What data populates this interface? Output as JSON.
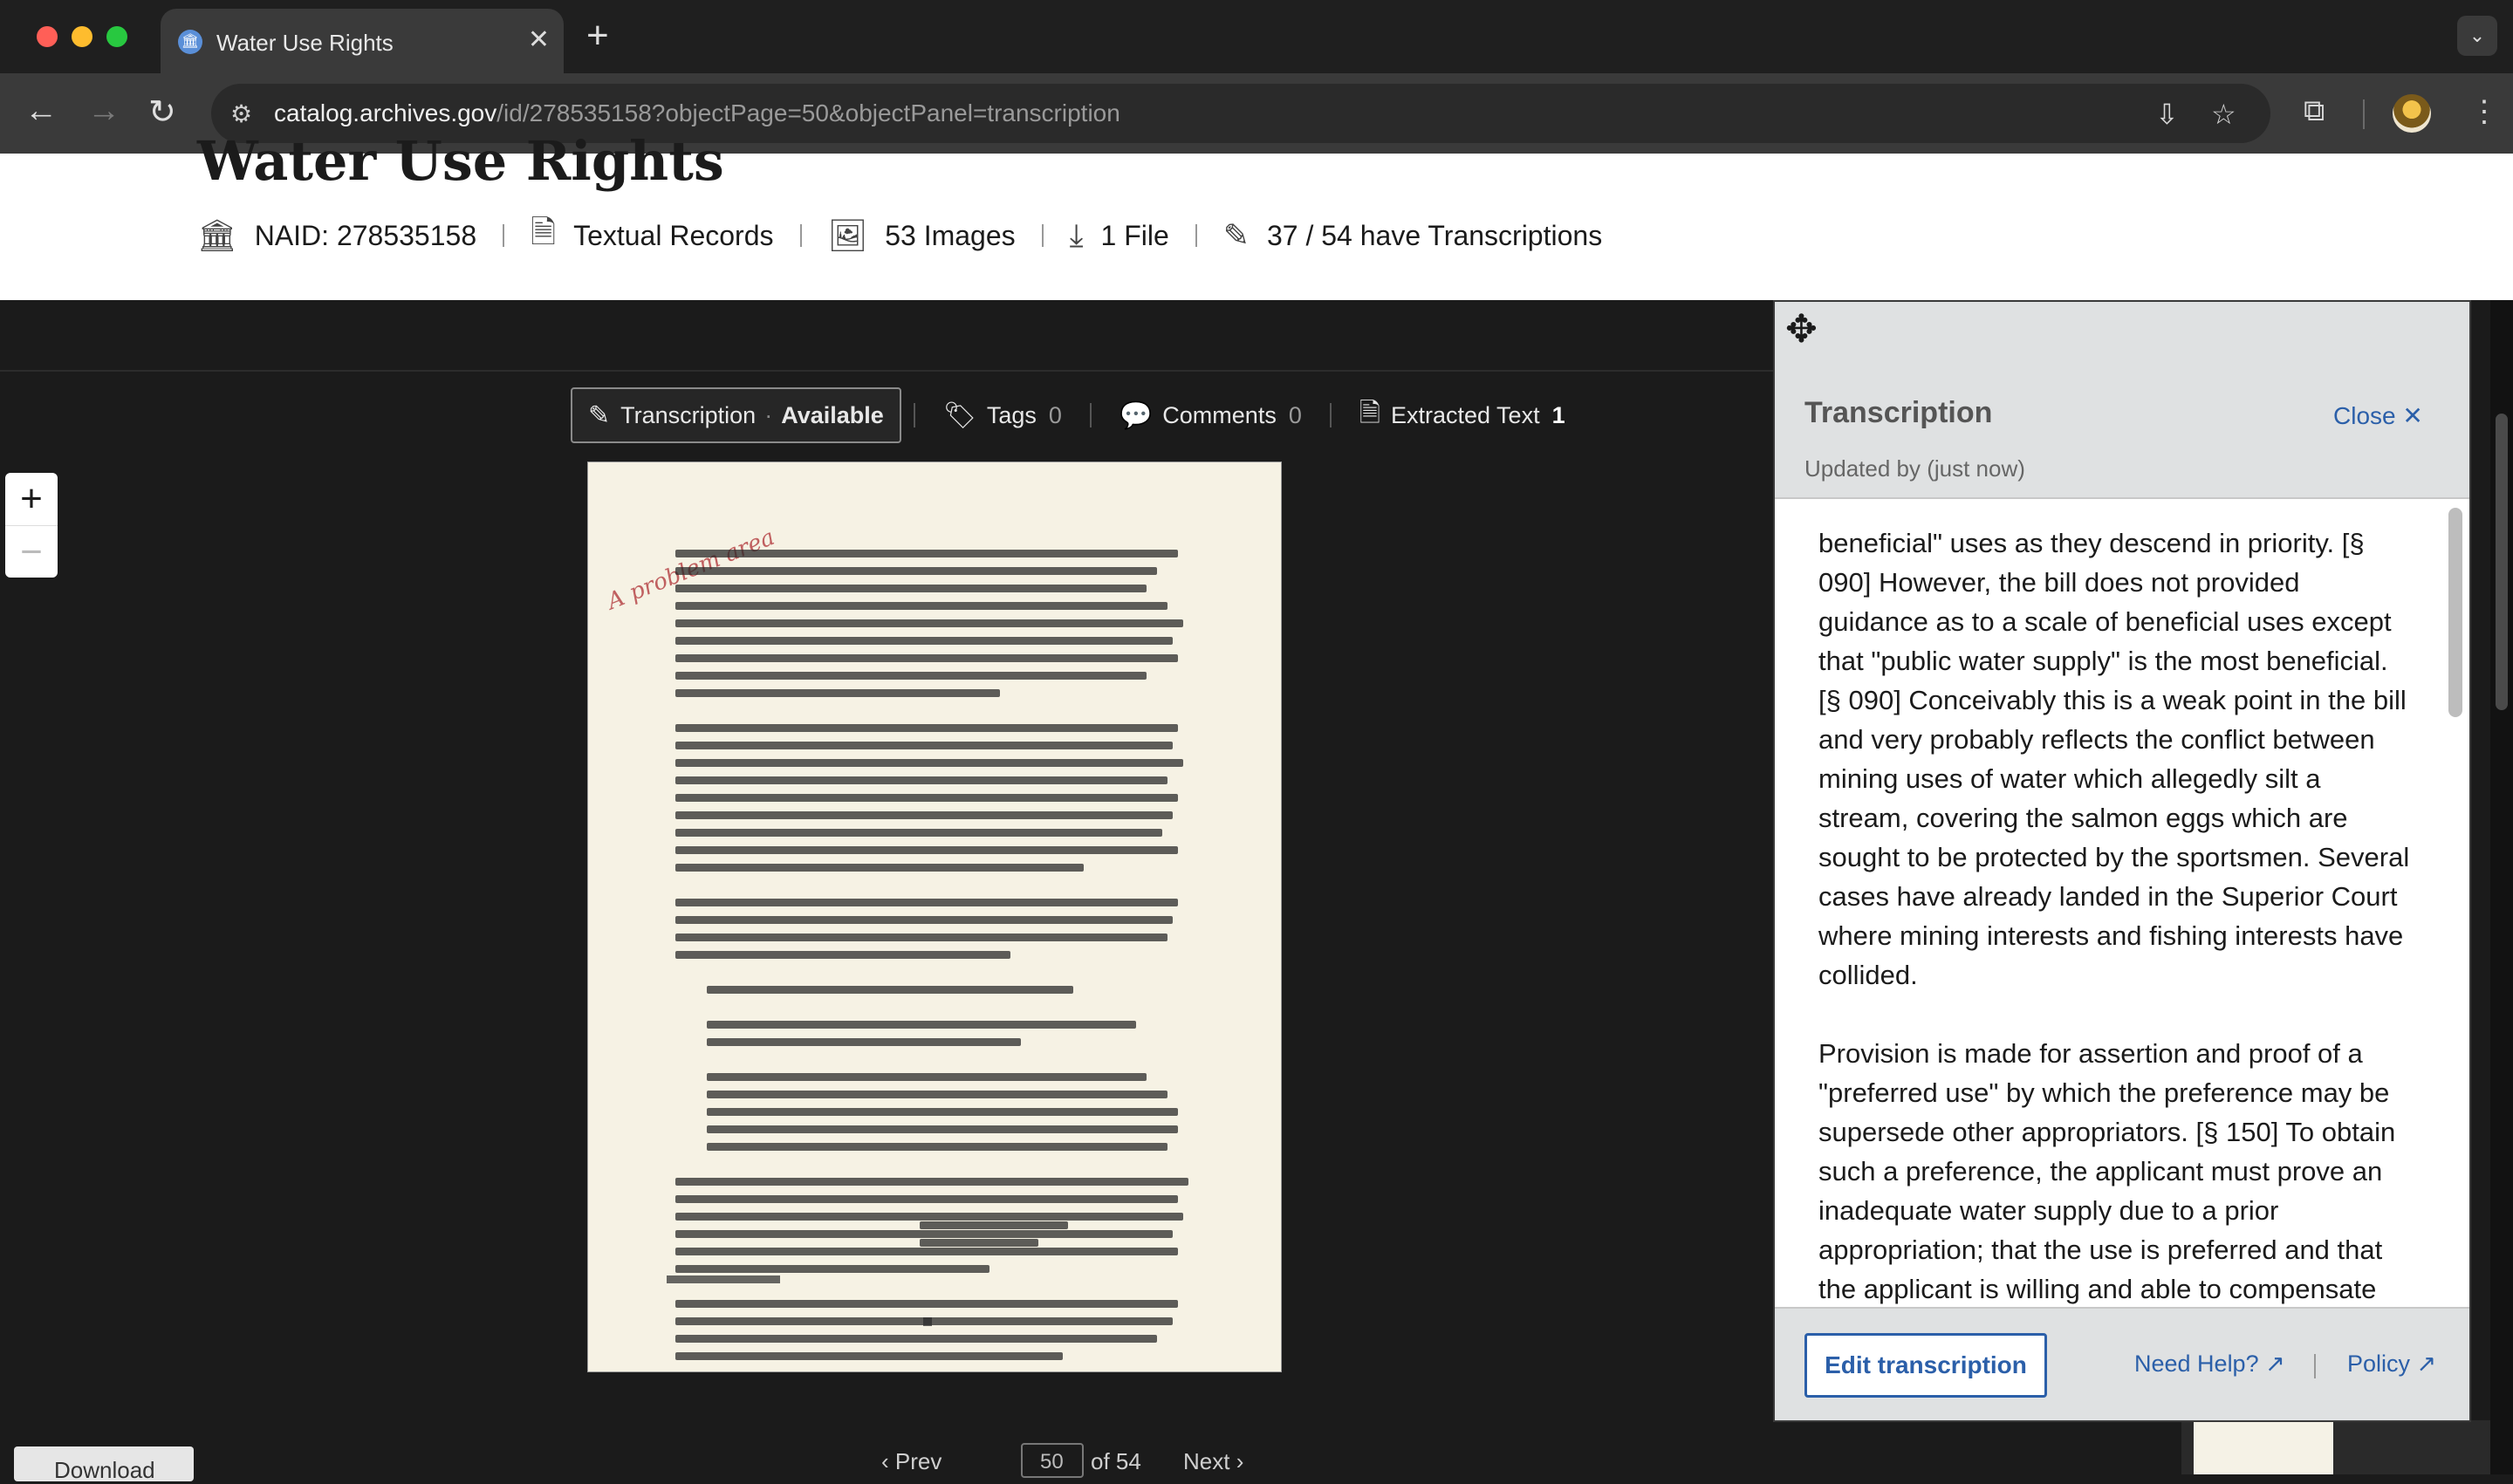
{
  "browser": {
    "tab_title": "Water Use Rights",
    "tab_favicon": "archives-icon",
    "url_host": "catalog.archives.gov",
    "url_path": "/id/278535158?objectPage=50&objectPanel=transcription"
  },
  "record": {
    "title": "Water Use Rights",
    "naid": "NAID: 278535158",
    "type": "Textual Records",
    "images": "53 Images",
    "files": "1 File",
    "transcriptions": "37 / 54 have Transcriptions"
  },
  "panel_tabs": {
    "transcription_label": "Transcription",
    "transcription_status": "Available",
    "tags_label": "Tags",
    "tags_count": "0",
    "comments_label": "Comments",
    "comments_count": "0",
    "extracted_label": "Extracted Text",
    "extracted_count": "1"
  },
  "document": {
    "annotation": "A problem area"
  },
  "pager": {
    "download": "Download",
    "prev": "Prev",
    "page": "50",
    "of": "of 54",
    "next": "Next"
  },
  "transcription": {
    "title": "Transcription",
    "close": "Close",
    "updated": "Updated by (just now)",
    "paragraph1": "beneficial\" uses as they descend in priority. [§ 090] However, the bill does not provided guidance as to a scale of beneficial uses except that \"public water supply\" is the most beneficial. [§ 090] Conceivably this is a weak point in the bill and very probably reflects the conflict between mining uses of water which allegedly silt a stream, covering the salmon eggs which are sought to be protected by the sportsmen. Several cases have already landed in the Superior Court where mining interests and fishing interests have collided.",
    "paragraph2": "Provision is made for assertion and proof of a \"preferred use\" by which the preference may be supersede other appropriators. [§ 150] To obtain such a preference, the applicant must prove an inadequate water supply due to a prior appropriation; that the use is preferred and that the applicant is willing and able to compensate the former user for his loss.",
    "edit_button": "Edit transcription",
    "need_help": "Need Help?",
    "policy": "Policy"
  },
  "colors": {
    "link": "#2b5fa9",
    "panel_bg": "#dfe1e2",
    "page_bg": "#1b1b1b"
  }
}
